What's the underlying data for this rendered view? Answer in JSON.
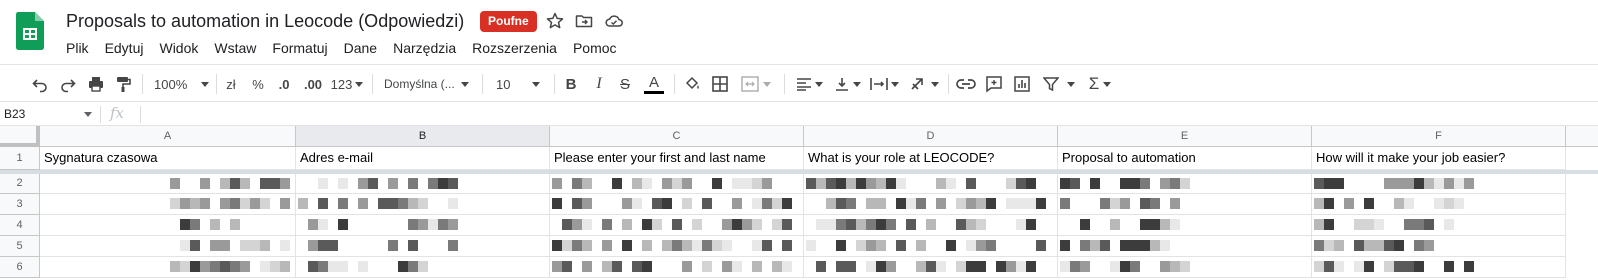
{
  "app": {
    "title": "Proposals to automation in Leocode (Odpowiedzi)",
    "badge": "Poufne",
    "brand_color": "#0f9d58",
    "badge_color": "#d93025",
    "title_icons": [
      "star-icon",
      "move-to-folder-icon",
      "cloud-saved-icon"
    ]
  },
  "menu": [
    "Plik",
    "Edytuj",
    "Widok",
    "Wstaw",
    "Formatuj",
    "Dane",
    "Narzędzia",
    "Rozszerzenia",
    "Pomoc"
  ],
  "toolbar": {
    "zoom": "100%",
    "currency": "zł",
    "percent": "%",
    "decrease_decimal": ".0",
    "increase_decimal": ".00",
    "more_formats": "123",
    "font": "Domyślna (...",
    "font_size": "10",
    "icons": [
      "undo-icon",
      "redo-icon",
      "print-icon",
      "paint-format-icon",
      "bold-icon",
      "italic-icon",
      "strikethrough-icon",
      "text-color-icon",
      "fill-color-icon",
      "borders-icon",
      "merge-cells-icon",
      "align-horizontal-icon",
      "align-vertical-icon",
      "text-wrap-icon",
      "text-rotate-icon",
      "link-icon",
      "comment-icon",
      "chart-icon",
      "filter-icon",
      "functions-icon"
    ]
  },
  "formula_bar": {
    "cell_ref": "B23",
    "fx": "fx",
    "value": ""
  },
  "grid": {
    "columns": [
      "A",
      "B",
      "C",
      "D",
      "E",
      "F"
    ],
    "selected_column": "B",
    "rows": [
      "1",
      "2",
      "3",
      "4",
      "5",
      "6"
    ],
    "header_row": [
      "Sygnatura czasowa",
      "Adres e-mail",
      "Please enter your first and last name",
      "What is your role at LEOCODE?",
      "Proposal to automation",
      "How will it make your job easier?"
    ]
  }
}
